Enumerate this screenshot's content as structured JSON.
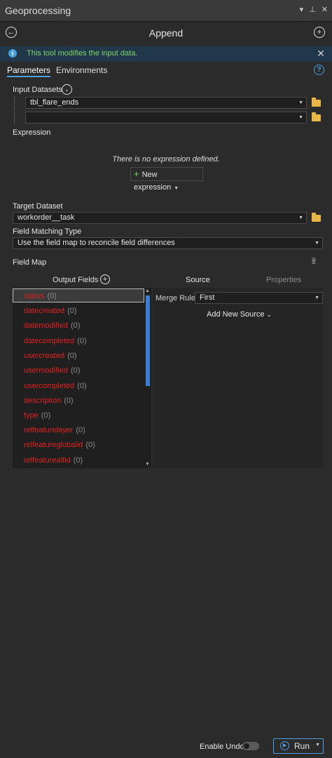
{
  "window": {
    "title": "Geoprocessing",
    "controls": [
      "▾",
      "⊥",
      "✕"
    ]
  },
  "header": {
    "tool_title": "Append"
  },
  "info": {
    "message": "This tool modifies the input data."
  },
  "tabs": {
    "parameters": "Parameters",
    "environments": "Environments"
  },
  "input_datasets": {
    "label": "Input Datasets",
    "rows": [
      "tbl_flare_ends",
      ""
    ]
  },
  "expression": {
    "label": "Expression",
    "empty_text": "There is no expression defined.",
    "new_button": "New expression"
  },
  "target_dataset": {
    "label": "Target Dataset",
    "value": "workorder__task"
  },
  "field_matching": {
    "label": "Field Matching Type",
    "value": "Use the field map to reconcile field differences"
  },
  "field_map": {
    "label": "Field Map",
    "output_fields_header": "Output Fields",
    "source_tab": "Source",
    "properties_tab": "Properties",
    "merge_rule_label": "Merge Rule",
    "merge_rule_value": "First",
    "add_new_source": "Add New Source",
    "fields": [
      {
        "name": "status",
        "count": "(0)"
      },
      {
        "name": "datecreated",
        "count": "(0)"
      },
      {
        "name": "datemodified",
        "count": "(0)"
      },
      {
        "name": "datecompleted",
        "count": "(0)"
      },
      {
        "name": "usercreated",
        "count": "(0)"
      },
      {
        "name": "usermodified",
        "count": "(0)"
      },
      {
        "name": "usercompleted",
        "count": "(0)"
      },
      {
        "name": "description",
        "count": "(0)"
      },
      {
        "name": "type",
        "count": "(0)"
      },
      {
        "name": "relfeaturelayer",
        "count": "(0)"
      },
      {
        "name": "relfeatureglobalid",
        "count": "(0)"
      },
      {
        "name": "relfeaturealtid",
        "count": "(0)"
      }
    ]
  },
  "footer": {
    "enable_undo": "Enable Undo",
    "run": "Run"
  },
  "colors": {
    "accent": "#4a9fdd",
    "info_text": "#7fd36a",
    "error_field": "#e02020",
    "folder": "#e8b746"
  }
}
